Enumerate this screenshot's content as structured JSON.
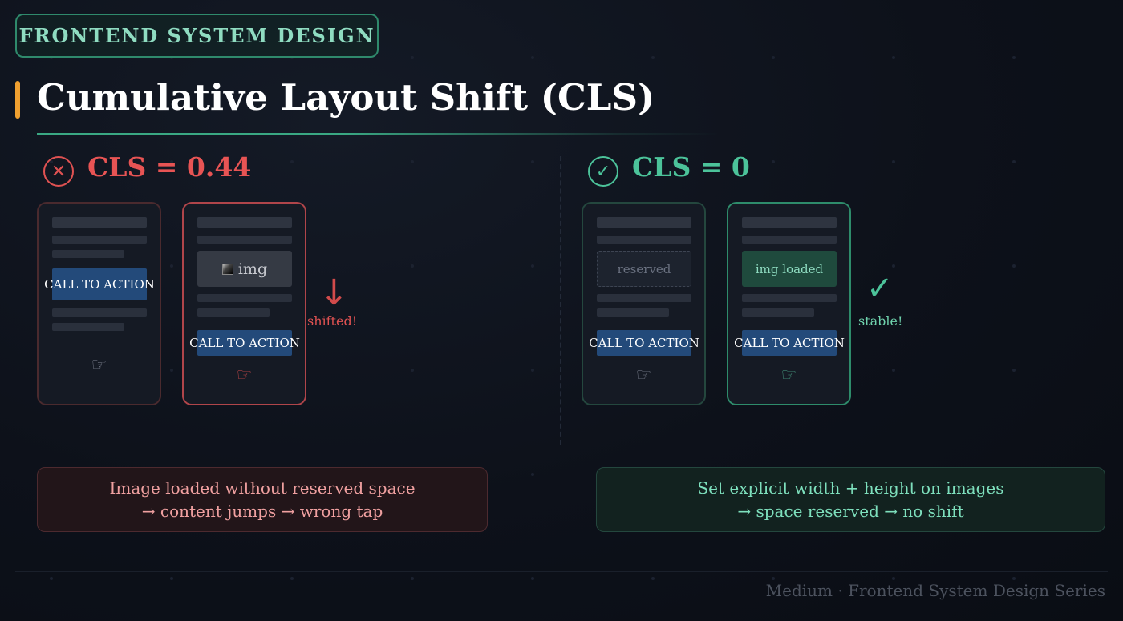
{
  "header": {
    "series_tag": "FRONTEND SYSTEM DESIGN",
    "title": "Cumulative Layout Shift (CLS)"
  },
  "bad": {
    "icon": "cross-circle-icon",
    "icon_glyph": "✕",
    "heading": "CLS = 0.44",
    "phones": [
      {
        "cta": "CALL TO ACTION",
        "hand_icon": "pointing-hand-icon"
      },
      {
        "media": "img",
        "cta": "CALL TO ACTION",
        "hand_icon": "pointing-hand-icon"
      }
    ],
    "arrow_glyph": "↓",
    "note": "shifted!",
    "summary_line1": "Image loaded without reserved space",
    "summary_line2": "→ content jumps → wrong tap"
  },
  "good": {
    "icon": "check-circle-icon",
    "icon_glyph": "✓",
    "heading": "CLS = 0",
    "phones": [
      {
        "media": "reserved",
        "cta": "CALL TO ACTION",
        "hand_icon": "pointing-hand-icon"
      },
      {
        "media": "img loaded",
        "cta": "CALL TO ACTION",
        "hand_icon": "pointing-hand-icon"
      }
    ],
    "check_glyph": "✓",
    "note": "stable!",
    "summary_line1": "Set explicit width + height on images",
    "summary_line2": "→ space reserved → no shift"
  },
  "hand_glyph": "☞",
  "footer": "Medium · Frontend System Design Series",
  "colors": {
    "accent_bad": "#e85454",
    "accent_good": "#4cc39a",
    "title_accent": "#f0a030",
    "cta_blue": "#234a7a"
  }
}
